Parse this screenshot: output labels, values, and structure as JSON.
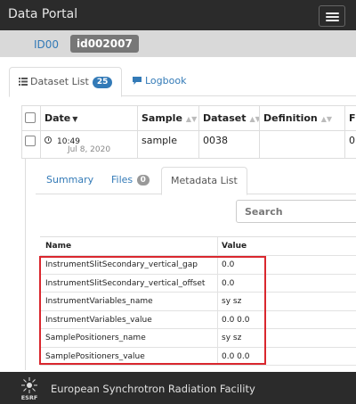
{
  "app": {
    "title": "Data Portal"
  },
  "breadcrumb": {
    "parent": "ID00",
    "current": "id002007"
  },
  "main_tabs": [
    {
      "label": "Dataset List",
      "badge": "25",
      "icon": "list-icon"
    },
    {
      "label": "Logbook",
      "icon": "comment-icon"
    }
  ],
  "dataset_table": {
    "columns": [
      "Date",
      "Sample",
      "Dataset",
      "Definition",
      "Fi"
    ],
    "row": {
      "time": "10:49",
      "date": "Jul 8, 2020",
      "sample": "sample",
      "dataset": "0038",
      "definition": "",
      "files": "0"
    }
  },
  "detail_tabs": [
    {
      "label": "Summary"
    },
    {
      "label": "Files",
      "badge": "0"
    },
    {
      "label": "Metadata List"
    }
  ],
  "search": {
    "placeholder": "Search"
  },
  "metadata": {
    "headers": {
      "name": "Name",
      "value": "Value"
    },
    "rows": [
      {
        "name": "InstrumentSlitSecondary_vertical_gap",
        "value": "0.0"
      },
      {
        "name": "InstrumentSlitSecondary_vertical_offset",
        "value": "0.0"
      },
      {
        "name": "InstrumentVariables_name",
        "value": "sy sz"
      },
      {
        "name": "InstrumentVariables_value",
        "value": "0.0 0.0"
      },
      {
        "name": "SamplePositioners_name",
        "value": "sy sz"
      },
      {
        "name": "SamplePositioners_value",
        "value": "0.0 0.0"
      }
    ]
  },
  "highlight_color": "#d9272e",
  "accent_color": "#337ab7",
  "footer": {
    "text": "European Synchrotron Radiation Facility",
    "logo_text": "ESRF"
  }
}
